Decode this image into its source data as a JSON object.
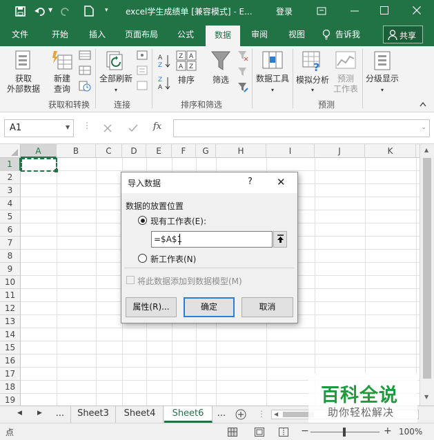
{
  "titlebar": {
    "filename": "excel学生成绩单 [兼容模式] - E...",
    "login": "登录"
  },
  "tabs": [
    "文件",
    "开始",
    "插入",
    "页面布局",
    "公式",
    "数据",
    "审阅",
    "视图",
    "告诉我",
    "共享"
  ],
  "ribbon": {
    "get_external": [
      "获取",
      "外部数据"
    ],
    "new_query": [
      "新建",
      "查询"
    ],
    "refresh_all": "全部刷新",
    "sort": "排序",
    "filter": "筛选",
    "data_tools": "数据工具",
    "what_if": "模拟分析",
    "forecast": [
      "预测",
      "工作表"
    ],
    "outline": "分级显示",
    "groups": [
      "获取和转换",
      "连接",
      "排序和筛选",
      "预测"
    ]
  },
  "formula_bar": {
    "name_box": "A1",
    "fx": "fx",
    "value": ""
  },
  "columns": [
    "A",
    "B",
    "C",
    "D",
    "E",
    "F",
    "G",
    "H",
    "I",
    "J",
    "K"
  ],
  "rows": [
    "1",
    "2",
    "3",
    "4",
    "5",
    "6",
    "7",
    "8",
    "9",
    "10",
    "11",
    "12",
    "13",
    "14",
    "15",
    "16",
    "17",
    "18",
    "19"
  ],
  "dialog": {
    "title": "导入数据",
    "help": "?",
    "close": "✕",
    "section": "数据的放置位置",
    "existing_sheet": "现有工作表(E):",
    "ref_value": "=$A$1",
    "new_sheet": "新工作表(N)",
    "add_model": "将此数据添加到数据模型(M)",
    "properties": "属性(R)...",
    "ok": "确定",
    "cancel": "取消"
  },
  "sheets": [
    "...",
    "Sheet3",
    "Sheet4",
    "Sheet6",
    "..."
  ],
  "status": {
    "zoom": "100%"
  },
  "watermark": {
    "main": "百科全说",
    "sub": "助你轻松解决"
  },
  "colors": {
    "accent": "#217346",
    "watermark": "#1f9a3c"
  }
}
